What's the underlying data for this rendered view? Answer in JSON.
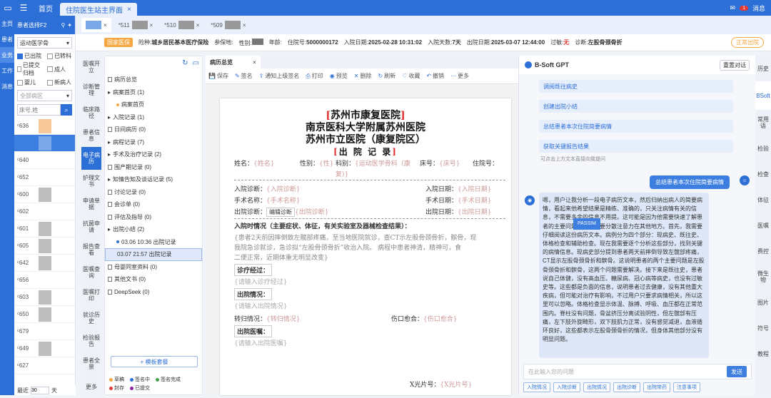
{
  "topbar": {
    "home": "首页",
    "tab": "住院医生站主界面",
    "msg": "消息",
    "msg_count": "1"
  },
  "leftnav": [
    "主页",
    "患者",
    "业务",
    "工作",
    "消息"
  ],
  "patpanel": {
    "header": "患者选择F2",
    "dept": "运动医学骨",
    "checks": [
      {
        "label": "已出院",
        "on": true
      },
      {
        "label": "已转科",
        "on": false
      },
      {
        "label": "已提交归档",
        "on": false
      },
      {
        "label": "成人",
        "on": false
      },
      {
        "label": "婴儿",
        "on": false
      },
      {
        "label": "新病人",
        "on": false
      }
    ],
    "select_all": "全部病区",
    "search_placeholder": "床号,姓",
    "beds": [
      "636",
      "",
      "640",
      "652",
      "600",
      "602",
      "601",
      "605",
      "642",
      "656",
      "603",
      "650",
      "679",
      "649",
      "627"
    ],
    "footer_prefix": "最近",
    "footer_days": "30",
    "footer_unit": "天"
  },
  "tabs": [
    "",
    "511",
    "510",
    "509"
  ],
  "info": {
    "tag": "国家医保",
    "insurance_label": "险种:",
    "insurance": "城乡居民基本医疗保险",
    "ref_label": "参保地:",
    "gender_label": "性别:",
    "age_label": "年龄:",
    "hosp_no_label": "住院号:",
    "hosp_no": "5000000172",
    "admit_label": "入院日期:",
    "admit": "2025-02-28 10:31:02",
    "days_label": "入院天数:",
    "days": "7天",
    "discharge_label": "出院日期:",
    "discharge": "2025-03-07 12:44:00",
    "allergy_label": "过敏:",
    "allergy": "无",
    "diag_label": "诊断:",
    "diag": "左股骨颈骨折",
    "status": "正常出院"
  },
  "sidemenu": [
    "医嘱开立",
    "诊断管理",
    "临床路径",
    "患者信息",
    "电子病历",
    "护理文书",
    "申请单据",
    "抗菌申请",
    "报告查看",
    "医嘱查询",
    "医嘱打印",
    "就诊历史",
    "检验报告",
    "患者全景",
    "更多"
  ],
  "tree": {
    "nodes": [
      {
        "label": "病历总览",
        "lvl": 0,
        "icon": "doc"
      },
      {
        "label": "病案首页 (1)",
        "lvl": 0,
        "icon": "arrow"
      },
      {
        "label": "病案首页",
        "lvl": 1,
        "icon": "dot"
      },
      {
        "label": "入院记录 (1)",
        "lvl": 0,
        "icon": "arrow"
      },
      {
        "label": "日间病历 (0)",
        "lvl": 0,
        "icon": "doc"
      },
      {
        "label": "病程记录 (7)",
        "lvl": 0,
        "icon": "arrow"
      },
      {
        "label": "手术及治疗记录 (2)",
        "lvl": 0,
        "icon": "arrow"
      },
      {
        "label": "围产期记录 (0)",
        "lvl": 0,
        "icon": "doc"
      },
      {
        "label": "知情告知及谈话记录 (5)",
        "lvl": 0,
        "icon": "arrow"
      },
      {
        "label": "讨论记录 (0)",
        "lvl": 0,
        "icon": "doc"
      },
      {
        "label": "会诊单 (0)",
        "lvl": 0,
        "icon": "doc"
      },
      {
        "label": "评估及指导 (0)",
        "lvl": 0,
        "icon": "doc"
      },
      {
        "label": "出院小结 (2)",
        "lvl": 0,
        "icon": "arrow"
      },
      {
        "label": "03.06 10:36 出院记录",
        "lvl": 1,
        "icon": "bdot"
      },
      {
        "label": "03.07 21:57 出院记录",
        "lvl": 1,
        "icon": "none",
        "act": true
      },
      {
        "label": "母婴同室资料 (0)",
        "lvl": 0,
        "icon": "doc"
      },
      {
        "label": "其他文书 (0)",
        "lvl": 0,
        "icon": "doc"
      },
      {
        "label": "DeepSeek (0)",
        "lvl": 0,
        "icon": "doc"
      }
    ],
    "template_btn": "+ 模板套餐",
    "legend": [
      {
        "label": "草稿",
        "color": "#f5a742"
      },
      {
        "label": "签名中",
        "color": "#2c6fd6"
      },
      {
        "label": "签名完成",
        "color": "#43a047"
      },
      {
        "label": "封存",
        "color": "#e53935"
      },
      {
        "label": "已提交",
        "color": "#8e24aa"
      }
    ]
  },
  "editor": {
    "tab": "病历总览",
    "tools": [
      "保存",
      "签名",
      "通知上级签名",
      "打印",
      "预览",
      "删除",
      "刷新",
      "收藏",
      "撤销",
      "更多"
    ]
  },
  "doc": {
    "brand": "苏州市康复医院",
    "line2": "南京医科大学附属苏州医院",
    "line3": "苏州市立医院（康复院区）",
    "title": "出 院 记 录",
    "name_label": "姓名：",
    "name_ph": "{姓名}",
    "gender_label": "性别：",
    "gender_ph": "{性}",
    "dept_label": "科别：",
    "dept_ph": "{运动医学骨科（康",
    "bed_label": "床号：",
    "bed_ph": "{床号}",
    "hno_label": "住院号：",
    "dept_cont": "复)}",
    "adm_diag_label": "入院诊断：",
    "adm_diag_ph": "{入院诊断}",
    "adm_date_label": "入院日期：",
    "adm_date_ph": "{入院日期}",
    "op_label": "手术名称：",
    "op_ph": "{手术名称}",
    "op_date_label": "手术日期：",
    "op_date_ph": "{手术日期}",
    "dis_diag_label": "出院诊断：",
    "dis_diag_btn": "编辑诊断",
    "dis_diag_ph": "{出院诊断}",
    "dis_date_label": "出院日期：",
    "dis_date_ph": "{出院日期}",
    "sec1": "入院时情况（主要症状、体征，有关实验室及器械检查结果）：",
    "sec1_text1": "{患者2天前因摔倒致左髋部疼痛，至当地医院就诊，查CT示左股骨颈骨折，髌骨，现",
    "sec1_text2": "我院急诊就诊，急诊拟“左股骨颈骨折”收治入院。 病程中患者神清，精神可，食",
    "sec1_text3": "二便正常，近期体重无明显改变}",
    "treat_label": "诊疗经过：",
    "treat_ph": "{请输入诊疗经过}",
    "dis_state_label": "出院情况：",
    "dis_state_ph": "{请输入出院情况}",
    "transfer_label": "转归情况：",
    "transfer_ph": "{转归情况}",
    "wound_label": "伤口愈合：",
    "wound_ph": "{伤口愈合}",
    "order_label": "出院医嘱：",
    "order_ph": "{请输入出院医嘱}",
    "xray_label": "X光片号：",
    "xray_ph": "{X光片号}"
  },
  "gpt": {
    "title": "B-Soft GPT",
    "reset": "重置对话",
    "suggestions": [
      "调阅既往病史",
      "创建出院小结",
      "总结患者本次住院简要病情",
      "获取关键报告结果"
    ],
    "hint": "可点击上方文本直接向我提问",
    "user_msg": "总结患者本次住院简要病情",
    "answer": "嗯，用户让我分析一段电子病历文本，然后归纳出病人的简要病情，看起来他希望结果是精练、准确的，只关注病情有关的信息，不需要多余的信息不用提。这可能是因为他需要快速了解患者的主要问题，而不需要分散注意力在其他地方。首先，我需要仔细阅读这份病历文本。病例分为四个部分：现病史、既往史、体格检查和辅助检查。现在我需要逐个分析这些部分，找到关键的病情信息。现病史部分提到患者两天前摔倒导致左髋部疼痛，CT显示左股骨颈骨折和髌骨。这说明患者的两个主要问题是左股骨颈骨折和髌骨，这两个问题需要解决。接下来是既往史，患者说自己体健，没有高血压、糖尿病、冠心病等病史，也没有过敏史等。这些都是负面的信息，说明患者过去健康，没有其他重大疾病，但可能对治疗有影响，不过用户只要求病情相关，所以这里可以忽略。体格检查显示体温、脉搏、呼吸、血压都在正常范围内。脊柱没有问题，骨盆挤压分离试验阴性，但左髋部有压痛，左下肢外旋畸形，双下肢肌力正常，没有感觉减退，血液循环良好，这些都表示左股骨颈骨折的情况，但身体其他部分没有明显问题。",
    "passim": "PASSIM",
    "input_ph": "在此输入您的问题",
    "send": "发送",
    "quick": [
      "入院情况",
      "入院诊断",
      "出院情况",
      "出院诊断",
      "出院带药",
      "注意事项"
    ]
  },
  "rnav": [
    "历史",
    "BSoft",
    "常用语",
    "检验",
    "检查",
    "体征",
    "医嘱",
    "费控",
    "微生物",
    "图片",
    "符号",
    "教程"
  ]
}
